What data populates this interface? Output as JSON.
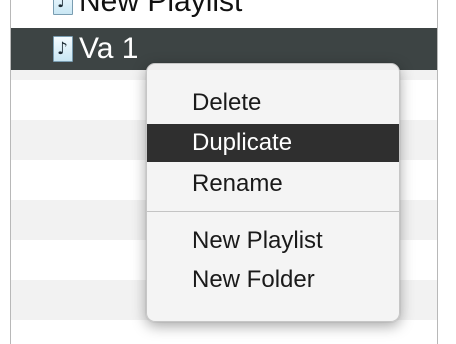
{
  "list": {
    "rows": [
      {
        "label": "New Playlist",
        "icon": "music-document-icon"
      },
      {
        "label": "Va 1",
        "icon": "music-document-icon",
        "selected": true
      }
    ]
  },
  "context_menu": {
    "items": [
      {
        "label": "Delete"
      },
      {
        "label": "Duplicate",
        "highlighted": true
      },
      {
        "label": "Rename"
      },
      {
        "label": "New Playlist"
      },
      {
        "label": "New Folder"
      }
    ],
    "highlight_color": "#2f2f2f"
  },
  "colors": {
    "selected_row_bg": "#3d4444",
    "selected_row_text": "#ffffff"
  }
}
